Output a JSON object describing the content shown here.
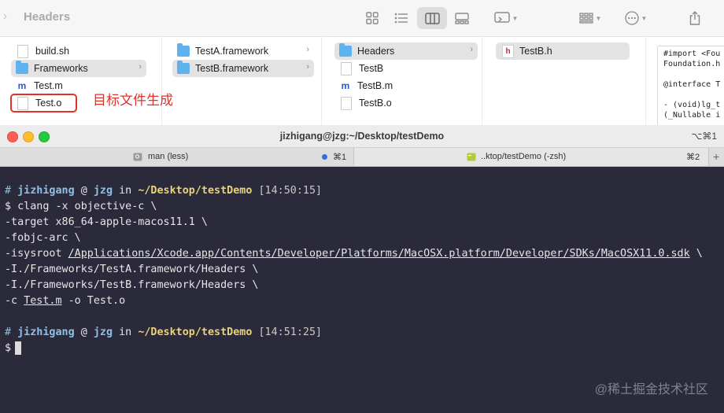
{
  "finder": {
    "title": "Headers",
    "columns": [
      {
        "items": [
          {
            "label": "build.sh",
            "icon": "doc-icon"
          },
          {
            "label": "Frameworks",
            "icon": "folder-icon",
            "selected": true,
            "chevron": "›"
          },
          {
            "label": "Test.m",
            "icon": "m-file-icon",
            "glyph": "m"
          },
          {
            "label": "Test.o",
            "icon": "doc-icon"
          }
        ]
      },
      {
        "items": [
          {
            "label": "TestA.framework",
            "icon": "folder-icon",
            "chevron": "›"
          },
          {
            "label": "TestB.framework",
            "icon": "folder-icon",
            "selected": true,
            "chevron": "›"
          }
        ]
      },
      {
        "items": [
          {
            "label": "Headers",
            "icon": "folder-icon",
            "selected": true,
            "chevron": "›"
          },
          {
            "label": "TestB",
            "icon": "doc-icon"
          },
          {
            "label": "TestB.m",
            "icon": "m-file-icon",
            "glyph": "m"
          },
          {
            "label": "TestB.o",
            "icon": "doc-icon"
          }
        ]
      },
      {
        "items": [
          {
            "label": "TestB.h",
            "icon": "h-file-icon",
            "glyph": "h",
            "selected": true
          }
        ]
      }
    ],
    "preview_lines": [
      "#import <Fou",
      "Foundation.h",
      "",
      "@interface T",
      "",
      "- (void)lg_t",
      "(_Nullable i"
    ],
    "annotation": "目标文件生成",
    "accent_color": "#e0322b",
    "folder_color": "#5eb2ef"
  },
  "terminal": {
    "title": "jizhigang@jzg:~/Desktop/testDemo",
    "title_shortcut": "⌥⌘1",
    "tabs": [
      {
        "label": "man (less)",
        "shortcut": "⌘1"
      },
      {
        "label": "..ktop/testDemo (-zsh)",
        "shortcut": "⌘2"
      }
    ],
    "new_tab_symbol": "+",
    "prompt1": {
      "hash": "#",
      "user": "jizhigang",
      "at": "@",
      "host": "jzg",
      "in": "in",
      "path": "~/Desktop/testDemo",
      "time": "[14:50:15]"
    },
    "command": {
      "line1_prefix": "$ clang -x objective-c \\",
      "line2": "-target x86_64-apple-macos11.1 \\",
      "line3": "-fobjc-arc \\",
      "line4_prefix": "-isysroot ",
      "line4_path": "/Applications/Xcode.app/Contents/Developer/Platforms/MacOSX.platform/Developer/SDKs/MacOSX11.0.sdk",
      "line4_suffix": " \\",
      "line5": "-I./Frameworks/TestA.framework/Headers \\",
      "line6": "-I./Frameworks/TestB.framework/Headers \\",
      "line7_prefix": "-c ",
      "line7_file": "Test.m",
      "line7_suffix": " -o Test.o"
    },
    "prompt2": {
      "hash": "#",
      "user": "jizhigang",
      "at": "@",
      "host": "jzg",
      "in": "in",
      "path": "~/Desktop/testDemo",
      "time": "[14:51:25]"
    },
    "final_prompt": "$",
    "colors": {
      "background": "#2b2a3a",
      "user": "#8dc0e8",
      "path": "#e8d27a"
    }
  },
  "watermark": "@稀土掘金技术社区"
}
